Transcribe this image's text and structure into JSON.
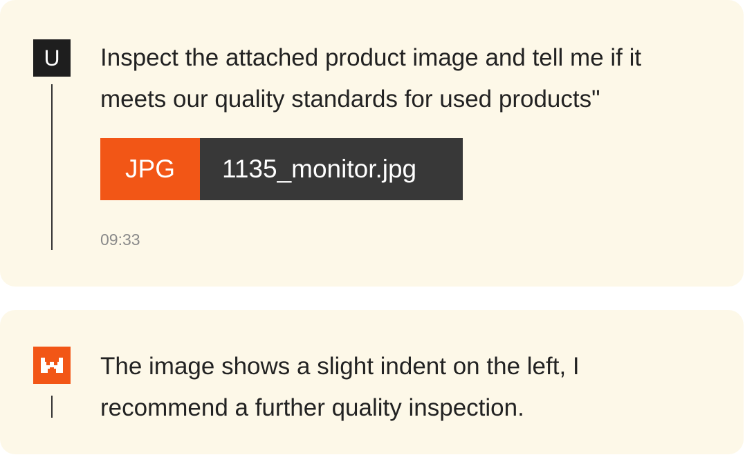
{
  "user_message": {
    "avatar_label": "U",
    "text": "Inspect the attached product image and tell me if it meets our quality standards for used products\"",
    "attachment": {
      "type_label": "JPG",
      "filename": "1135_monitor.jpg"
    },
    "timestamp": "09:33"
  },
  "assistant_message": {
    "avatar_icon": "robot-logo-icon",
    "text": "The image shows a slight indent on the left, I recommend a further quality inspection."
  },
  "colors": {
    "card_background": "#fdf8e8",
    "accent_orange": "#f25616",
    "dark": "#1e1e1e",
    "attachment_name_bg": "#383838",
    "timestamp_gray": "#8a8a8a"
  }
}
